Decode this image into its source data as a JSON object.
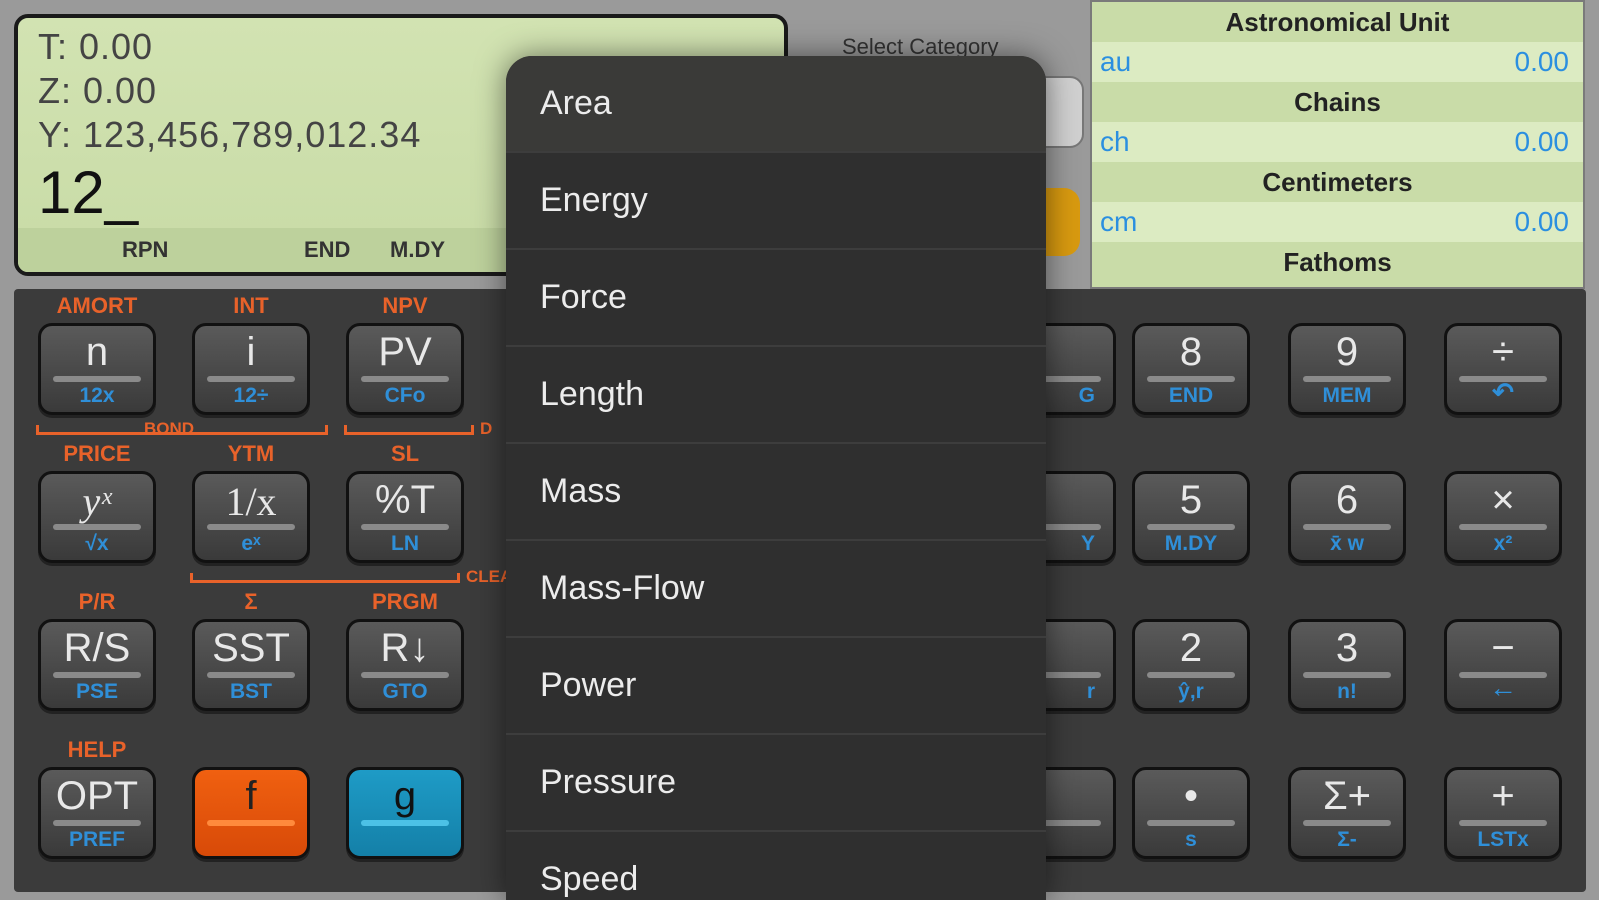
{
  "display": {
    "t_line": "T:  0.00",
    "z_line": "Z:  0.00",
    "y_line": "Y:  123,456,789,012.34",
    "x_entry": "12_",
    "status": {
      "mode": "RPN",
      "end": "END",
      "date": "M.DY"
    }
  },
  "select_category_label": "Select Category",
  "units_panel": [
    {
      "name": "Astronomical Unit",
      "abbr": "au",
      "value": "0.00"
    },
    {
      "name": "Chains",
      "abbr": "ch",
      "value": "0.00"
    },
    {
      "name": "Centimeters",
      "abbr": "cm",
      "value": "0.00"
    },
    {
      "name": "Fathoms"
    }
  ],
  "keys": {
    "n": {
      "label": "n",
      "sub": "12x",
      "flabel": "AMORT"
    },
    "i": {
      "label": "i",
      "sub": "12÷",
      "flabel": "INT"
    },
    "pv": {
      "label": "PV",
      "sub": "CFo",
      "flabel": "NPV"
    },
    "yx": {
      "label": "yˣ",
      "sub": "√x",
      "flabel": "PRICE"
    },
    "inv": {
      "label": "1/x",
      "sub": "eˣ",
      "flabel": "YTM"
    },
    "pct": {
      "label": "%T",
      "sub": "LN",
      "flabel": "SL"
    },
    "rs": {
      "label": "R/S",
      "sub": "PSE",
      "flabel": "P/R"
    },
    "sst": {
      "label": "SST",
      "sub": "BST",
      "flabel": "Σ"
    },
    "rdn": {
      "label": "R↓",
      "sub": "GTO",
      "flabel": "PRGM"
    },
    "opt": {
      "label": "OPT",
      "sub": "PREF",
      "flabel": "HELP"
    },
    "f": {
      "label": "f"
    },
    "g": {
      "label": "g"
    },
    "eight": {
      "label": "8",
      "sub": "END"
    },
    "nine": {
      "label": "9",
      "sub": "MEM"
    },
    "div": {
      "label": "÷",
      "sub": "↶"
    },
    "five": {
      "label": "5",
      "sub": "M.DY"
    },
    "six": {
      "label": "6",
      "sub": "x̄ w"
    },
    "mul": {
      "label": "×",
      "sub": "x²"
    },
    "two": {
      "label": "2",
      "sub": "ŷ,r"
    },
    "three": {
      "label": "3",
      "sub": "n!"
    },
    "minus": {
      "label": "−",
      "sub": "←"
    },
    "dot": {
      "label": "•",
      "sub": "s"
    },
    "sigma": {
      "label": "Σ+",
      "sub": "Σ-"
    },
    "plus": {
      "label": "+",
      "sub": "LSTx"
    },
    "partial_g": {
      "sub": "G"
    },
    "partial_y": {
      "sub": "Y"
    },
    "partial_r": {
      "sub": "r"
    }
  },
  "brackets": {
    "bond": "BOND",
    "d": "D",
    "clear": "CLEA"
  },
  "menu_items": [
    "Area",
    "Energy",
    "Force",
    "Length",
    "Mass",
    "Mass-Flow",
    "Power",
    "Pressure",
    "Speed"
  ]
}
